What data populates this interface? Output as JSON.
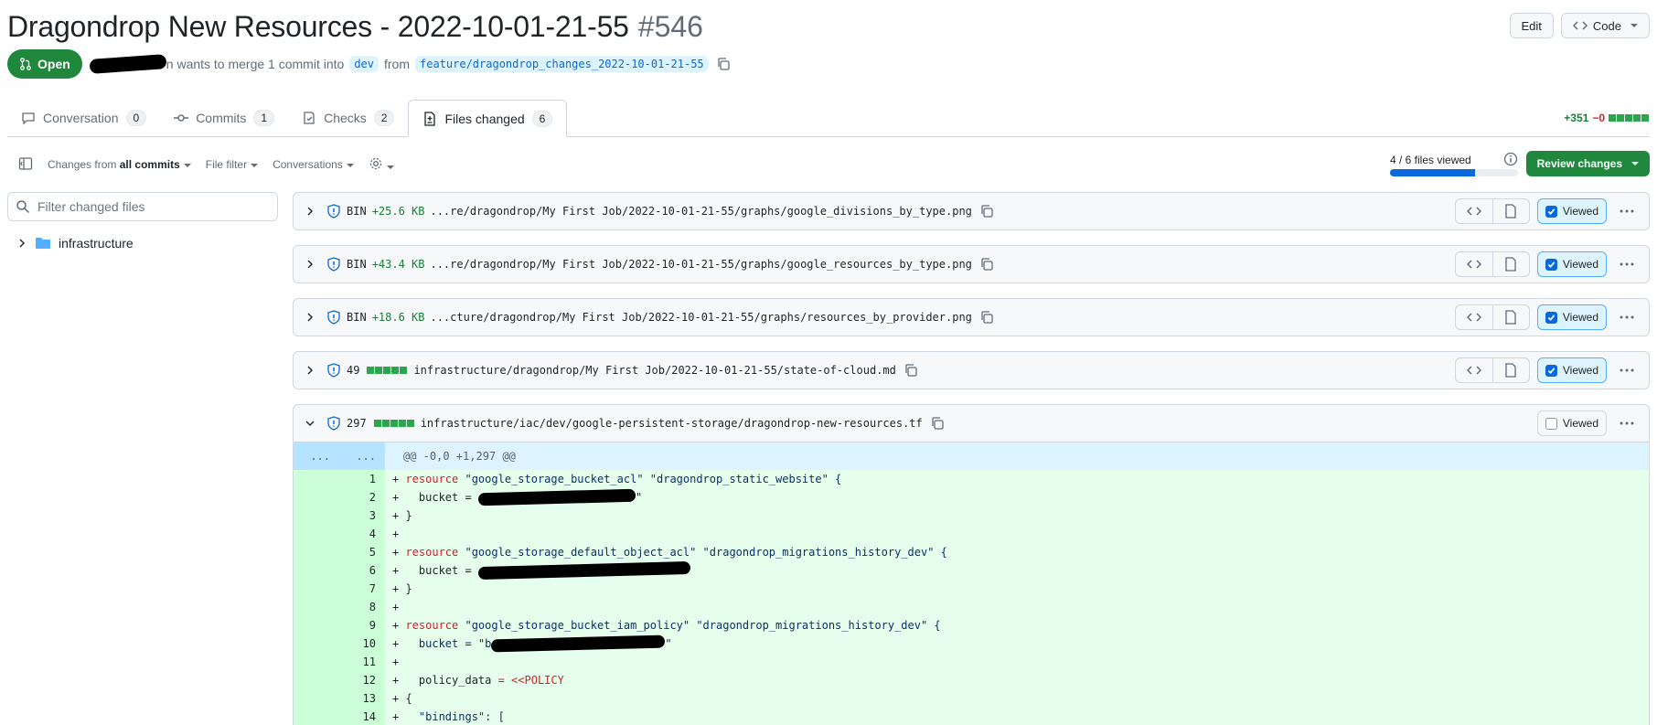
{
  "header": {
    "title": "Dragondrop New Resources - 2022-10-01-21-55",
    "number": "#546",
    "edit_label": "Edit",
    "code_label": "Code"
  },
  "meta": {
    "state": "Open",
    "merge_text": "n wants to merge 1 commit into",
    "base_branch": "dev",
    "from_text": "from",
    "head_branch": "feature/dragondrop_changes_2022-10-01-21-55"
  },
  "tabs": [
    {
      "label": "Conversation",
      "count": "0"
    },
    {
      "label": "Commits",
      "count": "1"
    },
    {
      "label": "Checks",
      "count": "2"
    },
    {
      "label": "Files changed",
      "count": "6"
    }
  ],
  "diffstat": {
    "additions": "+351",
    "deletions": "−0"
  },
  "toolbar": {
    "changes_prefix": "Changes from",
    "changes_value": "all commits",
    "file_filter": "File filter",
    "conversations": "Conversations",
    "viewed_text": "4 / 6 files viewed",
    "viewed_fraction": 0.667,
    "review_label": "Review changes"
  },
  "sidebar": {
    "filter_placeholder": "Filter changed files",
    "folder": "infrastructure"
  },
  "files": [
    {
      "kind": "BIN",
      "size": "+25.6 KB",
      "path": "...re/dragondrop/My First Job/2022-10-01-21-55/graphs/google_divisions_by_type.png",
      "viewed": true
    },
    {
      "kind": "BIN",
      "size": "+43.4 KB",
      "path": "...re/dragondrop/My First Job/2022-10-01-21-55/graphs/google_resources_by_type.png",
      "viewed": true
    },
    {
      "kind": "BIN",
      "size": "+18.6 KB",
      "path": "...cture/dragondrop/My First Job/2022-10-01-21-55/graphs/resources_by_provider.png",
      "viewed": true
    },
    {
      "kind": "49",
      "path": "infrastructure/dragondrop/My First Job/2022-10-01-21-55/state-of-cloud.md",
      "viewed": true
    },
    {
      "kind": "297",
      "path": "infrastructure/iac/dev/google-persistent-storage/dragondrop-new-resources.tf",
      "viewed": false
    }
  ],
  "viewed_label": "Viewed",
  "diff": {
    "hunk_left": "...",
    "hunk_right": "...",
    "hunk_header": "@@ -0,0 +1,297 @@",
    "lines": [
      {
        "n": "1",
        "kw": "resource",
        "rest": " \"google_storage_bucket_acl\" \"dragondrop_static_website\" {"
      },
      {
        "n": "2",
        "text": "  bucket = ",
        "tail": "\""
      },
      {
        "n": "3",
        "text": "}"
      },
      {
        "n": "4",
        "text": ""
      },
      {
        "n": "5",
        "kw": "resource",
        "rest": " \"google_storage_default_object_acl\" \"dragondrop_migrations_history_dev\" {"
      },
      {
        "n": "6",
        "text": "  bucket = ",
        "tail": ""
      },
      {
        "n": "7",
        "text": "}"
      },
      {
        "n": "8",
        "text": ""
      },
      {
        "n": "9",
        "kw": "resource",
        "rest": " \"google_storage_bucket_iam_policy\" \"dragondrop_migrations_history_dev\" {"
      },
      {
        "n": "10",
        "text": "  bucket = \"b",
        "tail": "\""
      },
      {
        "n": "11",
        "text": ""
      },
      {
        "n": "12",
        "text": "  policy_data ",
        "op": "= <<POLICY"
      },
      {
        "n": "13",
        "text": "{"
      },
      {
        "n": "14",
        "text": "  \"bindings\": ["
      }
    ]
  },
  "colors": {
    "open_green": "#1f883d",
    "link_blue": "#0969da",
    "add_bg": "#e6ffec"
  }
}
